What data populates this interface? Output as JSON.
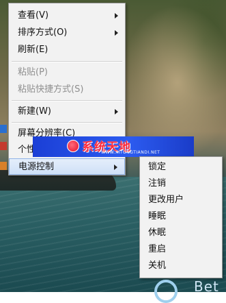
{
  "context_menu": {
    "items": [
      {
        "label": "查看(V)",
        "has_submenu": true,
        "enabled": true
      },
      {
        "label": "排序方式(O)",
        "has_submenu": true,
        "enabled": true
      },
      {
        "label": "刷新(E)",
        "has_submenu": false,
        "enabled": true
      },
      {
        "label": "粘贴(P)",
        "has_submenu": false,
        "enabled": false
      },
      {
        "label": "粘贴快捷方式(S)",
        "has_submenu": false,
        "enabled": false
      },
      {
        "label": "新建(W)",
        "has_submenu": true,
        "enabled": true
      },
      {
        "label": "屏幕分辨率(C)",
        "has_submenu": false,
        "enabled": true
      },
      {
        "label": "个性化(R)",
        "has_submenu": false,
        "enabled": true
      },
      {
        "label": "电源控制",
        "has_submenu": true,
        "enabled": true,
        "active": true
      }
    ]
  },
  "power_submenu": {
    "items": [
      "锁定",
      "注销",
      "更改用户",
      "睡眠",
      "休眠",
      "重启",
      "关机"
    ]
  },
  "watermark": {
    "title": "系统天地",
    "url": "WWW.XITONGTIANDI.NET"
  },
  "brand_logo": {
    "text": "Bet"
  },
  "colors": {
    "menu_bg": "#f2f2f2",
    "highlight": "#cfe0f7",
    "watermark_blue": "#2c5bf0",
    "watermark_red": "#ff2a3a"
  }
}
